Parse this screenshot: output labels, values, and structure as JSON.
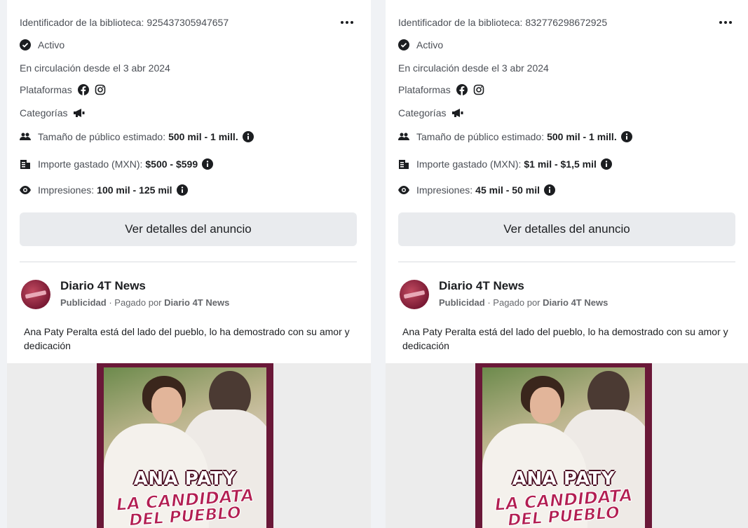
{
  "cards": [
    {
      "library_id_label": "Identificador de la biblioteca: 925437305947657",
      "status": "Activo",
      "running_since": "En circulación desde el 3 abr 2024",
      "platforms_label": "Plataformas",
      "categories_label": "Categorías",
      "audience_label": "Tamaño de público estimado:",
      "audience_value": "500 mil - 1 mill.",
      "spent_label": "Importe gastado (MXN):",
      "spent_value": "$500 - $599",
      "impressions_label": "Impresiones:",
      "impressions_value": "100 mil - 125 mil",
      "details_button": "Ver detalles del anuncio",
      "page_name": "Diario 4T News",
      "sponsored_label": "Publicidad",
      "paid_by_prefix": " · Pagado por ",
      "paid_by": "Diario 4T News",
      "ad_text": "Ana Paty Peralta está del lado del pueblo, lo ha demostrado con su amor y dedicación",
      "creative_line1": "ANA PATY",
      "creative_line2": "LA CANDIDATA",
      "creative_line3": "DEL PUEBLO"
    },
    {
      "library_id_label": "Identificador de la biblioteca: 832776298672925",
      "status": "Activo",
      "running_since": "En circulación desde el 3 abr 2024",
      "platforms_label": "Plataformas",
      "categories_label": "Categorías",
      "audience_label": "Tamaño de público estimado:",
      "audience_value": "500 mil - 1 mill.",
      "spent_label": "Importe gastado (MXN):",
      "spent_value": "$1 mil - $1,5 mil",
      "impressions_label": "Impresiones:",
      "impressions_value": "45 mil - 50 mil",
      "details_button": "Ver detalles del anuncio",
      "page_name": "Diario 4T News",
      "sponsored_label": "Publicidad",
      "paid_by_prefix": " · Pagado por ",
      "paid_by": "Diario 4T News",
      "ad_text": "Ana Paty Peralta está del lado del pueblo, lo ha demostrado con su amor y dedicación",
      "creative_line1": "ANA PATY",
      "creative_line2": "LA CANDIDATA",
      "creative_line3": "DEL PUEBLO"
    }
  ],
  "icons": {
    "status": "check-circle-icon",
    "platforms": [
      "facebook-icon",
      "instagram-icon"
    ],
    "categories": "megaphone-icon",
    "audience": "people-icon",
    "spent": "money-icon",
    "impressions": "eye-icon",
    "info": "info-icon",
    "more": "more-options-icon"
  },
  "colors": {
    "card_bg": "#ffffff",
    "page_bg": "#f0f2f5",
    "button_bg": "#e9ebee",
    "brand": "#6a1838"
  }
}
